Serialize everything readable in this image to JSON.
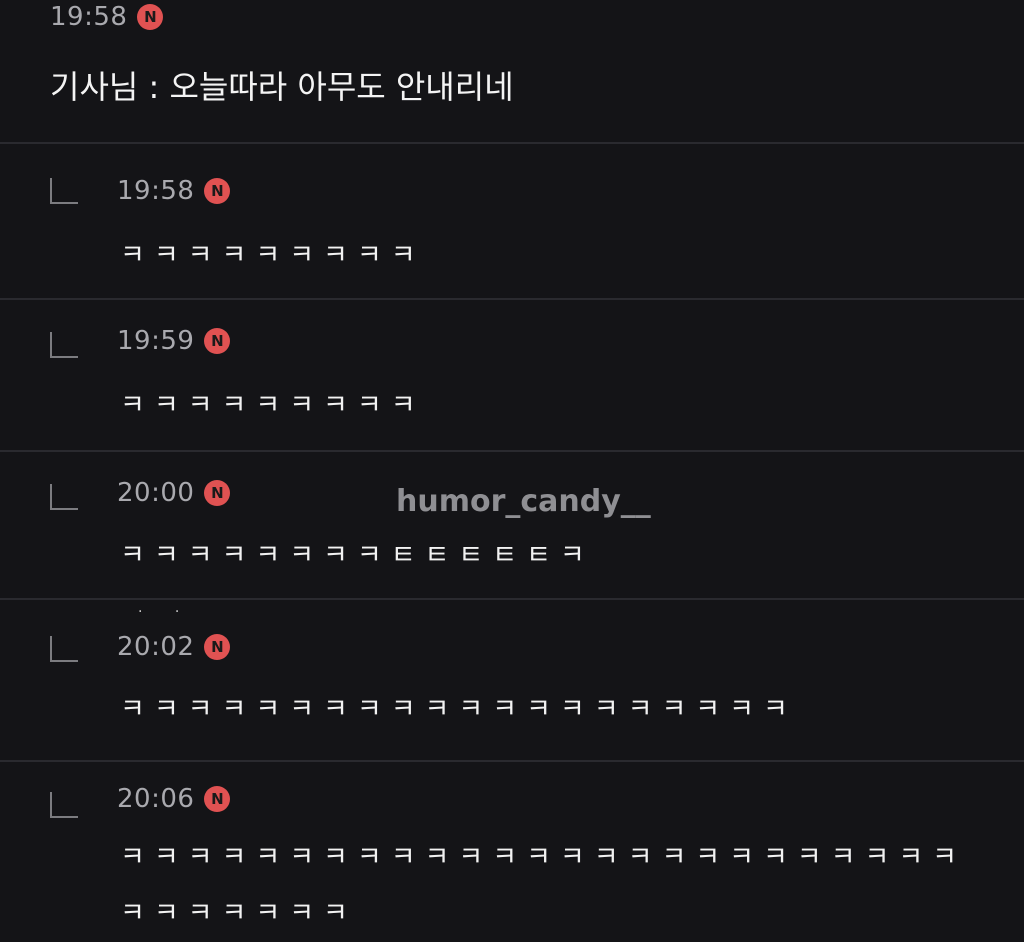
{
  "top_comment": {
    "time": "19:58",
    "badge": "N",
    "text": "기사님 : 오늘따라 아무도 안내리네"
  },
  "replies": [
    {
      "time": "19:58",
      "badge": "N",
      "text": "ㅋㅋㅋㅋㅋㅋㅋㅋㅋ"
    },
    {
      "time": "19:59",
      "badge": "N",
      "text": "ㅋㅋㅋㅋㅋㅋㅋㅋㅋ"
    },
    {
      "time": "20:00",
      "badge": "N",
      "text": "ㅋㅋㅋㅋㅋㅋㅋㅋㅌㅌㅌㅌㅌㅋ"
    },
    {
      "time": "20:02",
      "badge": "N",
      "text": "ㅋㅋㅋㅋㅋㅋㅋㅋㅋㅋㅋㅋㅋㅋㅋㅋㅋㅋㅋㅋ"
    },
    {
      "time": "20:06",
      "badge": "N",
      "text": "ㅋㅋㅋㅋㅋㅋㅋㅋㅋㅋㅋㅋㅋㅋㅋㅋㅋㅋㅋㅋㅋㅋㅋㅋㅋ ㅋㅋㅋㅋㅋㅋㅋ"
    }
  ],
  "ellipsis": "· ·",
  "watermark": "humor_candy__",
  "colors": {
    "background": "#141417",
    "badge": "#e05252",
    "divider": "#2a2a2f"
  }
}
